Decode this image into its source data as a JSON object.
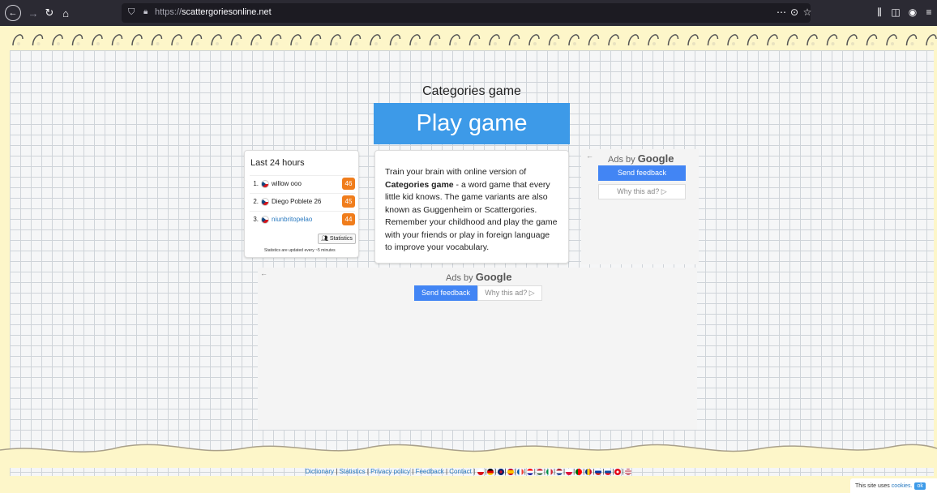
{
  "browser": {
    "url_prefix": "https://",
    "url_host": "scattergoriesonline.net",
    "icons": [
      "back-icon",
      "forward-icon",
      "reload-icon",
      "home-icon",
      "shield-icon",
      "lock-icon",
      "page-actions-icon",
      "pocket-icon",
      "bookmark-star-icon",
      "library-icon",
      "sidebar-icon",
      "account-icon",
      "menu-icon"
    ]
  },
  "main": {
    "title": "Categories game",
    "play_button": "Play game"
  },
  "stats": {
    "title": "Last 24 hours",
    "rows": [
      {
        "rank": "1.",
        "name": "willow ooo",
        "score": "46"
      },
      {
        "rank": "2.",
        "name": "Diego Poblete 26",
        "score": "45"
      },
      {
        "rank": "3.",
        "name": "niunbritopelao",
        "score": "44"
      }
    ],
    "button": "Statistics",
    "note": "Statistics are updated every ~5 minutes"
  },
  "description": {
    "lead": "Train your brain with online version of ",
    "bold": "Categories game",
    "rest": " - a word game that every little kid knows. The game variants are also known as Guggenheim or Scattergories. Remember your childhood and play the game with your friends or play in foreign language to improve your vocabulary."
  },
  "ads": {
    "ads_by": "Ads by ",
    "google": "Google",
    "send_feedback": "Send feedback",
    "why_this_ad": "Why this ad? ▷",
    "back_arrow": "←"
  },
  "footer": {
    "links": [
      "Dictionary",
      "Statistics",
      "Privacy policy",
      "Feedback",
      "Contact"
    ],
    "separator": "|"
  },
  "cookie": {
    "text": "This site uses",
    "link": "cookies.",
    "ok": "ok"
  },
  "colors": {
    "accent": "#3d9ae8",
    "score_badge": "#f07d1c",
    "google_blue": "#4285f4"
  }
}
